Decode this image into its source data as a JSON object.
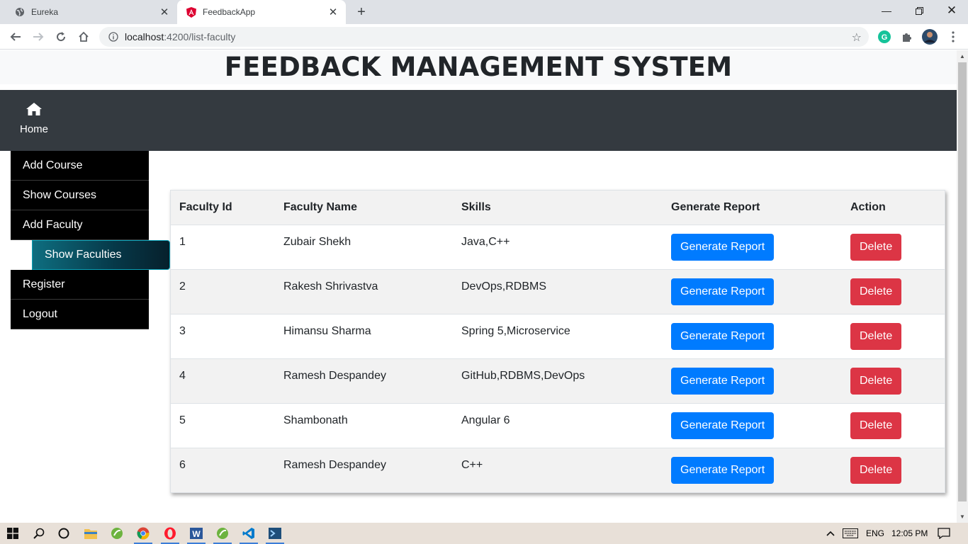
{
  "browser": {
    "tabs": [
      {
        "title": "Eureka",
        "active": false
      },
      {
        "title": "FeedbackApp",
        "active": true
      }
    ],
    "url_host": "localhost",
    "url_path": ":4200/list-faculty"
  },
  "app": {
    "title": "FEEDBACK MANAGEMENT SYSTEM",
    "nav": {
      "home_label": "Home"
    }
  },
  "sidebar": {
    "items": [
      {
        "label": "Add Course"
      },
      {
        "label": "Show Courses"
      },
      {
        "label": "Add Faculty"
      },
      {
        "label": "Show Faculties",
        "active": true
      },
      {
        "label": "Register"
      },
      {
        "label": "Logout"
      }
    ]
  },
  "table": {
    "headers": [
      "Faculty Id",
      "Faculty Name",
      "Skills",
      "Generate Report",
      "Action"
    ],
    "rows": [
      {
        "id": "1",
        "name": "Zubair Shekh",
        "skills": "Java,C++",
        "report": "Generate Report",
        "action": "Delete"
      },
      {
        "id": "2",
        "name": "Rakesh Shrivastva",
        "skills": "DevOps,RDBMS",
        "report": "Generate Report",
        "action": "Delete"
      },
      {
        "id": "3",
        "name": "Himansu Sharma",
        "skills": "Spring 5,Microservice",
        "report": "Generate Report",
        "action": "Delete"
      },
      {
        "id": "4",
        "name": "Ramesh Despandey",
        "skills": "GitHub,RDBMS,DevOps",
        "report": "Generate Report",
        "action": "Delete"
      },
      {
        "id": "5",
        "name": "Shambonath",
        "skills": "Angular 6",
        "report": "Generate Report",
        "action": "Delete"
      },
      {
        "id": "6",
        "name": "Ramesh Despandey",
        "skills": "C++",
        "report": "Generate Report",
        "action": "Delete"
      }
    ]
  },
  "taskbar": {
    "language": "ENG",
    "time": "12:05 PM"
  },
  "colors": {
    "navbar": "#343a40",
    "primary": "#007bff",
    "danger": "#dc3545",
    "sidebar": "#000000",
    "active_item": "#0e6e80"
  }
}
